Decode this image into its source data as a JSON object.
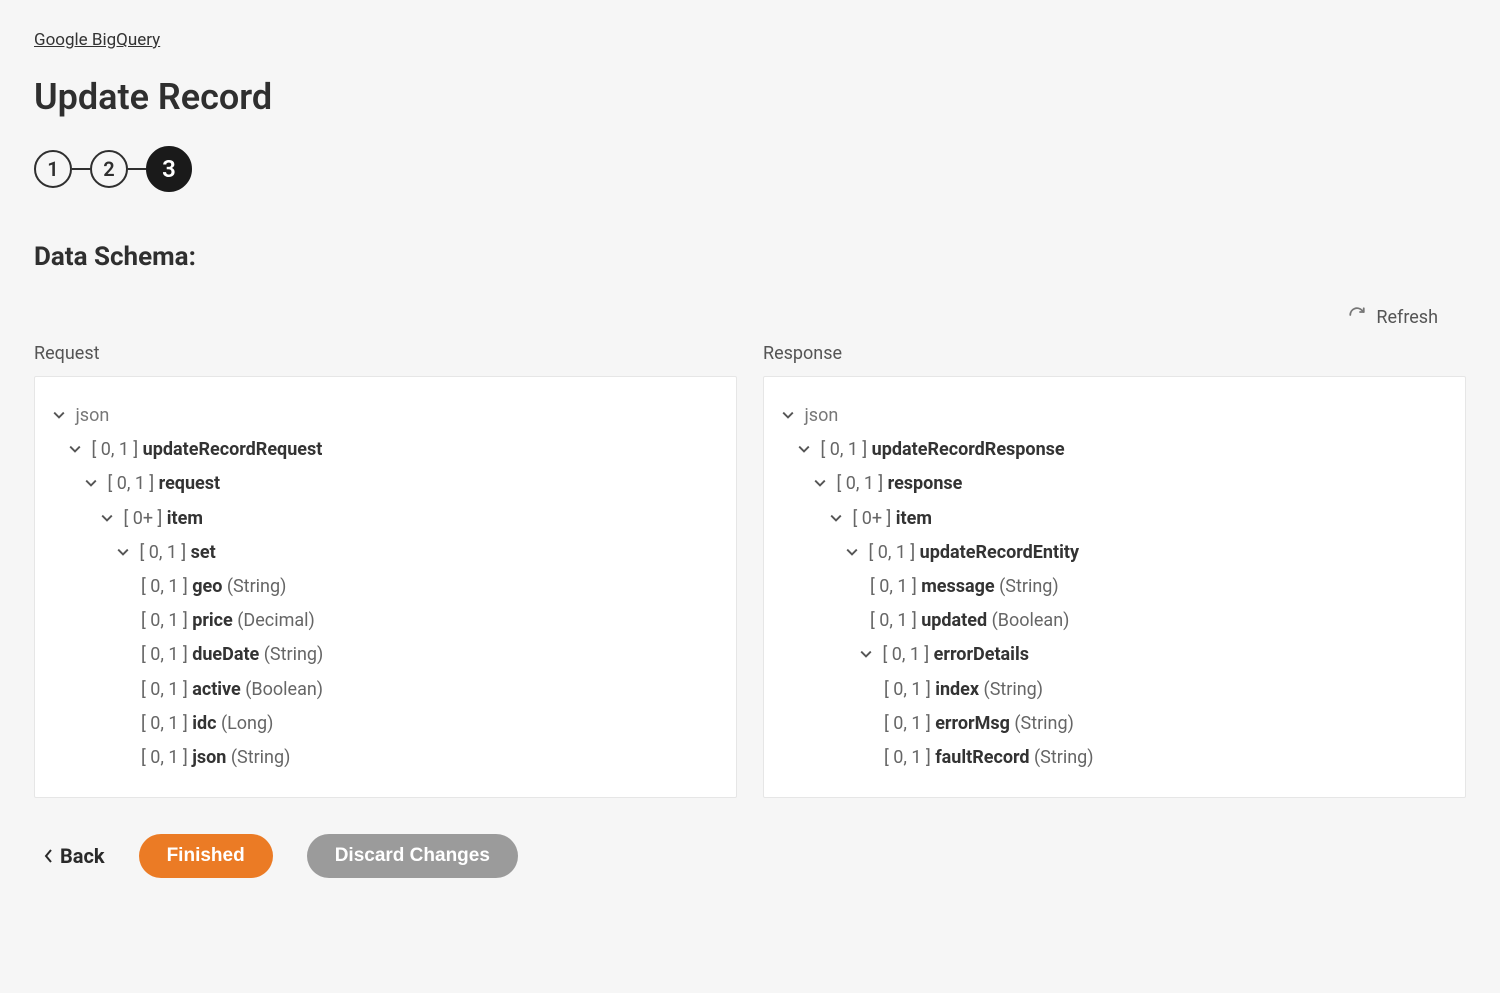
{
  "breadcrumb": "Google BigQuery",
  "page_title": "Update Record",
  "steps": {
    "s1": "1",
    "s2": "2",
    "s3": "3"
  },
  "section_title": "Data Schema:",
  "refresh": "Refresh",
  "columns": {
    "request_label": "Request",
    "response_label": "Response"
  },
  "req": {
    "root": "json",
    "n1_card": "[ 0, 1 ]",
    "n1_name": "updateRecordRequest",
    "n2_card": "[ 0, 1 ]",
    "n2_name": "request",
    "n3_card": "[ 0+ ]",
    "n3_name": "item",
    "n4_card": "[ 0, 1 ]",
    "n4_name": "set",
    "f1_card": "[ 0, 1 ]",
    "f1_name": "geo",
    "f1_type": "(String)",
    "f2_card": "[ 0, 1 ]",
    "f2_name": "price",
    "f2_type": "(Decimal)",
    "f3_card": "[ 0, 1 ]",
    "f3_name": "dueDate",
    "f3_type": "(String)",
    "f4_card": "[ 0, 1 ]",
    "f4_name": "active",
    "f4_type": "(Boolean)",
    "f5_card": "[ 0, 1 ]",
    "f5_name": "idc",
    "f5_type": "(Long)",
    "f6_card": "[ 0, 1 ]",
    "f6_name": "json",
    "f6_type": "(String)"
  },
  "res": {
    "root": "json",
    "n1_card": "[ 0, 1 ]",
    "n1_name": "updateRecordResponse",
    "n2_card": "[ 0, 1 ]",
    "n2_name": "response",
    "n3_card": "[ 0+ ]",
    "n3_name": "item",
    "n4_card": "[ 0, 1 ]",
    "n4_name": "updateRecordEntity",
    "f1_card": "[ 0, 1 ]",
    "f1_name": "message",
    "f1_type": "(String)",
    "f2_card": "[ 0, 1 ]",
    "f2_name": "updated",
    "f2_type": "(Boolean)",
    "n5_card": "[ 0, 1 ]",
    "n5_name": "errorDetails",
    "g1_card": "[ 0, 1 ]",
    "g1_name": "index",
    "g1_type": "(String)",
    "g2_card": "[ 0, 1 ]",
    "g2_name": "errorMsg",
    "g2_type": "(String)",
    "g3_card": "[ 0, 1 ]",
    "g3_name": "faultRecord",
    "g3_type": "(String)"
  },
  "actions": {
    "back": "Back",
    "finished": "Finished",
    "discard": "Discard Changes"
  }
}
